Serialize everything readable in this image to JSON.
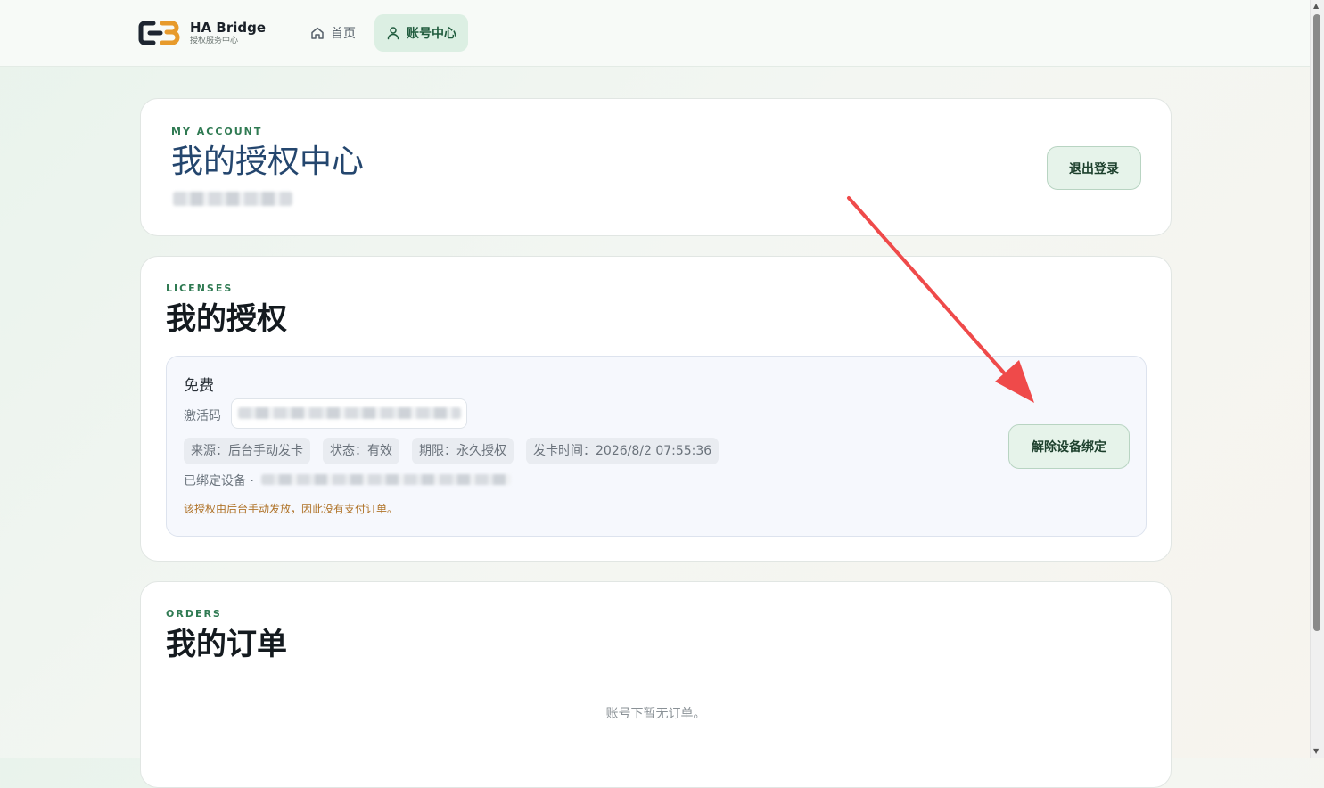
{
  "brand": {
    "name": "HA Bridge",
    "subtitle": "授权服务中心",
    "logo_icon": "link-logo-icon"
  },
  "nav": {
    "home": {
      "label": "首页",
      "icon": "home-icon"
    },
    "account": {
      "label": "账号中心",
      "icon": "user-icon",
      "active": true
    }
  },
  "account": {
    "eyebrow": "MY ACCOUNT",
    "title": "我的授权中心",
    "logout_label": "退出登录"
  },
  "licenses": {
    "eyebrow": "LICENSES",
    "title": "我的授权",
    "item": {
      "type": "免费",
      "activation_label": "激活码",
      "chips": {
        "source": "来源：后台手动发卡",
        "status": "状态：有效",
        "term": "期限：永久授权",
        "issued": "发卡时间：2026/8/2 07:55:36"
      },
      "bound_label": "已绑定设备 ·",
      "note": "该授权由后台手动发放，因此没有支付订单。",
      "unbind_label": "解除设备绑定"
    }
  },
  "orders": {
    "eyebrow": "ORDERS",
    "title": "我的订单",
    "empty_text": "账号下暂无订单。"
  },
  "colors": {
    "accent_green": "#2f7a52",
    "annotation_arrow": "#ef4a4a",
    "note_text": "#b0742a"
  }
}
